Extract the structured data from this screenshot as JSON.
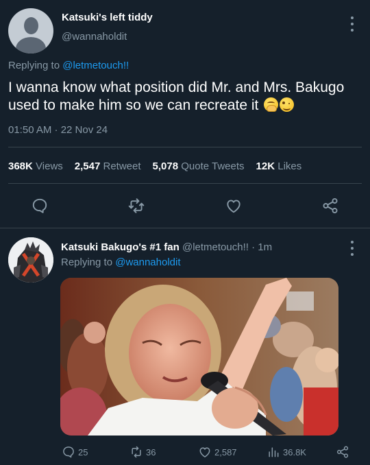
{
  "main_tweet": {
    "display_name": "Katsuki's left tiddy",
    "handle": "@wannaholdit",
    "replying_prefix": "Replying to",
    "replying_to": "@letmetouch!!",
    "text": "I wanna know what position did Mr. and Mrs. Bakugo used to make him so we can recreate it",
    "emojis": [
      "face-with-hand-over-mouth",
      "winking-face"
    ],
    "timestamp": "01:50 AM · 22 Nov 24",
    "stats": {
      "views_count": "368K",
      "views_label": "Views",
      "retweets_count": "2,547",
      "retweets_label": "Retweet",
      "quotes_count": "5,078",
      "quotes_label": "Quote Tweets",
      "likes_count": "12K",
      "likes_label": "Likes"
    },
    "actions": [
      "reply-icon",
      "retweet-icon",
      "like-icon",
      "share-icon"
    ]
  },
  "reply_tweet": {
    "display_name": "Katsuki Bakugo's #1 fan",
    "handle_time": "@letmetouch!! · 1m",
    "replying_prefix": "Replying to",
    "replying_to": "@wannaholdit",
    "media_description_icon": "crying-girl-photo",
    "actions": {
      "replies": "25",
      "retweets": "36",
      "likes": "2,587",
      "views": "36.8K"
    }
  },
  "colors": {
    "background": "#15202b",
    "secondary_text": "#8899a6",
    "link": "#1d9bf0",
    "divider": "#38444d"
  }
}
